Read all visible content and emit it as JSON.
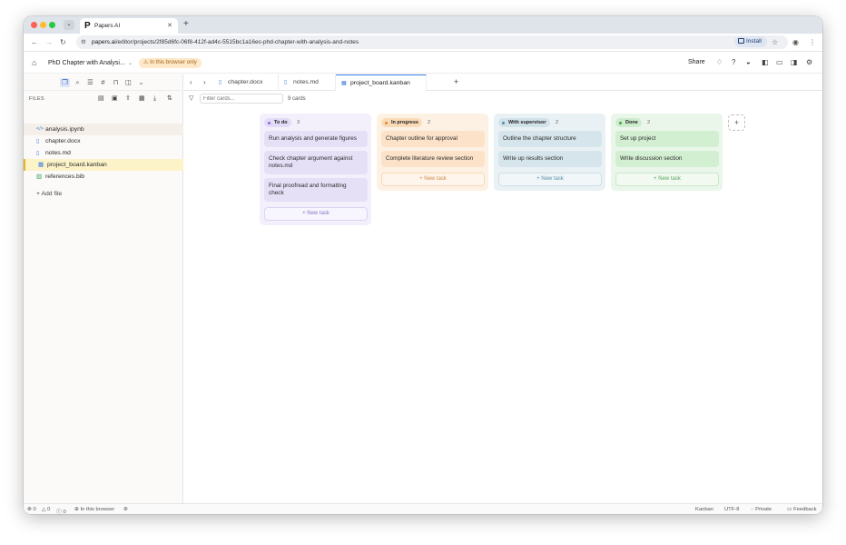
{
  "browser": {
    "tab_title": "Papers AI",
    "favicon": "P",
    "url_prefix": "",
    "url_host": "papers.ai",
    "url_path": "/editor/projects/2f85d6fc-06f8-412f-ad4c-5515bc1a16ec-phd-chapter-with-analysis-and-notes",
    "install_label": "Install"
  },
  "header": {
    "project_title": "PhD Chapter with Analysi...",
    "storage_badge": "In this browser only",
    "share_label": "Share"
  },
  "sidebar": {
    "files_label": "FILES",
    "add_file_label": "Add file",
    "files": [
      {
        "name": "analysis.ipynb",
        "icon": "code-icon",
        "color": "#3b7be0"
      },
      {
        "name": "chapter.docx",
        "icon": "document-icon",
        "color": "#3b7be0"
      },
      {
        "name": "notes.md",
        "icon": "document-icon",
        "color": "#3b7be0"
      },
      {
        "name": "project_board.kanban",
        "icon": "board-icon",
        "color": "#3b7be0"
      },
      {
        "name": "references.bib",
        "icon": "bib-icon",
        "color": "#2e9e5b"
      }
    ]
  },
  "editor_tabs": [
    {
      "label": "chapter.docx"
    },
    {
      "label": "notes.md"
    },
    {
      "label": "project_board.kanban"
    }
  ],
  "filter": {
    "placeholder": "Filter cards...",
    "count_label": "9 cards"
  },
  "board": {
    "new_task_label": "New task",
    "columns": [
      {
        "title": "To do",
        "count": "3",
        "bg": "#f3f0fc",
        "badge_bg": "#e3dcf7",
        "dot": "#8a6be0",
        "card_bg": "#e6e0f7",
        "btn_color": "#8d78c9",
        "btn_border": "#dcd4f2",
        "cards": [
          "Run analysis and generate figures",
          "Check chapter argument against notes.md",
          "Final proofread and formatting check"
        ]
      },
      {
        "title": "In progress",
        "count": "2",
        "bg": "#fdf1e4",
        "badge_bg": "#fadbb8",
        "dot": "#e08a2e",
        "card_bg": "#fbe2c8",
        "btn_color": "#d08a45",
        "btn_border": "#f6d9b9",
        "cards": [
          "Chapter outline for approval",
          "Complete literature review section"
        ]
      },
      {
        "title": "With supervisor",
        "count": "2",
        "bg": "#eaf1f4",
        "badge_bg": "#d2e2ea",
        "dot": "#4f8aa6",
        "card_bg": "#d6e5ec",
        "btn_color": "#5a8fa8",
        "btn_border": "#cfdfe7",
        "cards": [
          "Outline the chapter structure",
          "Write up results section"
        ]
      },
      {
        "title": "Done",
        "count": "2",
        "bg": "#eaf6ea",
        "badge_bg": "#cfeccf",
        "dot": "#3aa544",
        "card_bg": "#d3efd2",
        "btn_color": "#56a85d",
        "btn_border": "#cbe8ca",
        "cards": [
          "Set up project",
          "Write discussion section"
        ]
      }
    ]
  },
  "statusbar": {
    "errors": "0",
    "warnings": "0",
    "infos": "0",
    "location": "In this browser",
    "mode": "Kanban",
    "encoding": "UTF-8",
    "privacy": "Private",
    "feedback": "Feedback"
  }
}
